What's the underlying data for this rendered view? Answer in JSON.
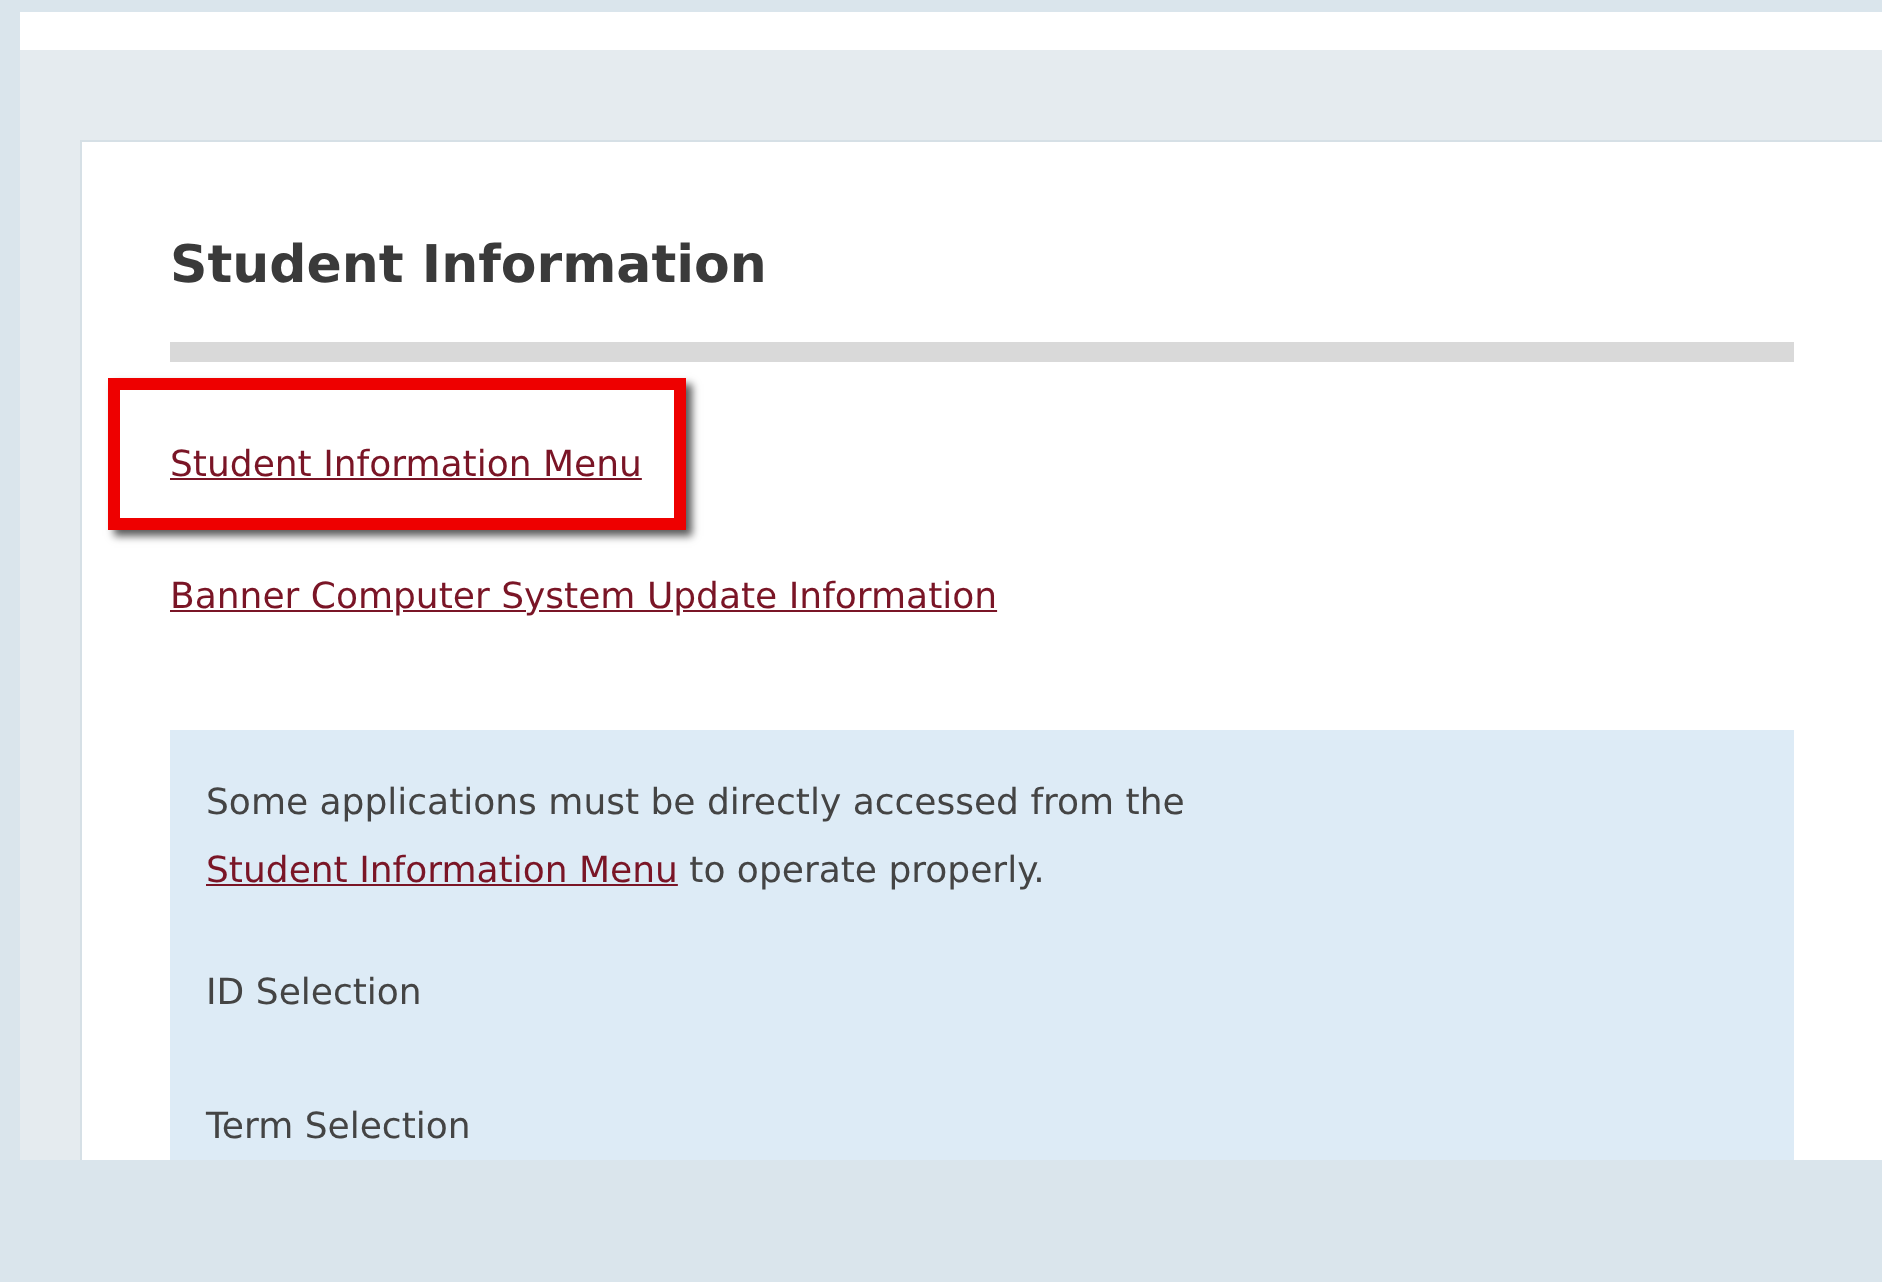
{
  "section": {
    "title": "Student Information"
  },
  "links": [
    {
      "label": "Student Information Menu",
      "highlighted": true
    },
    {
      "label": "Banner Computer System Update Information",
      "highlighted": false
    }
  ],
  "note": {
    "text_before": "Some applications must be directly accessed from the ",
    "link": "Student Information Menu",
    "text_after": " to operate properly."
  },
  "items": [
    "ID Selection",
    "Term Selection"
  ]
}
